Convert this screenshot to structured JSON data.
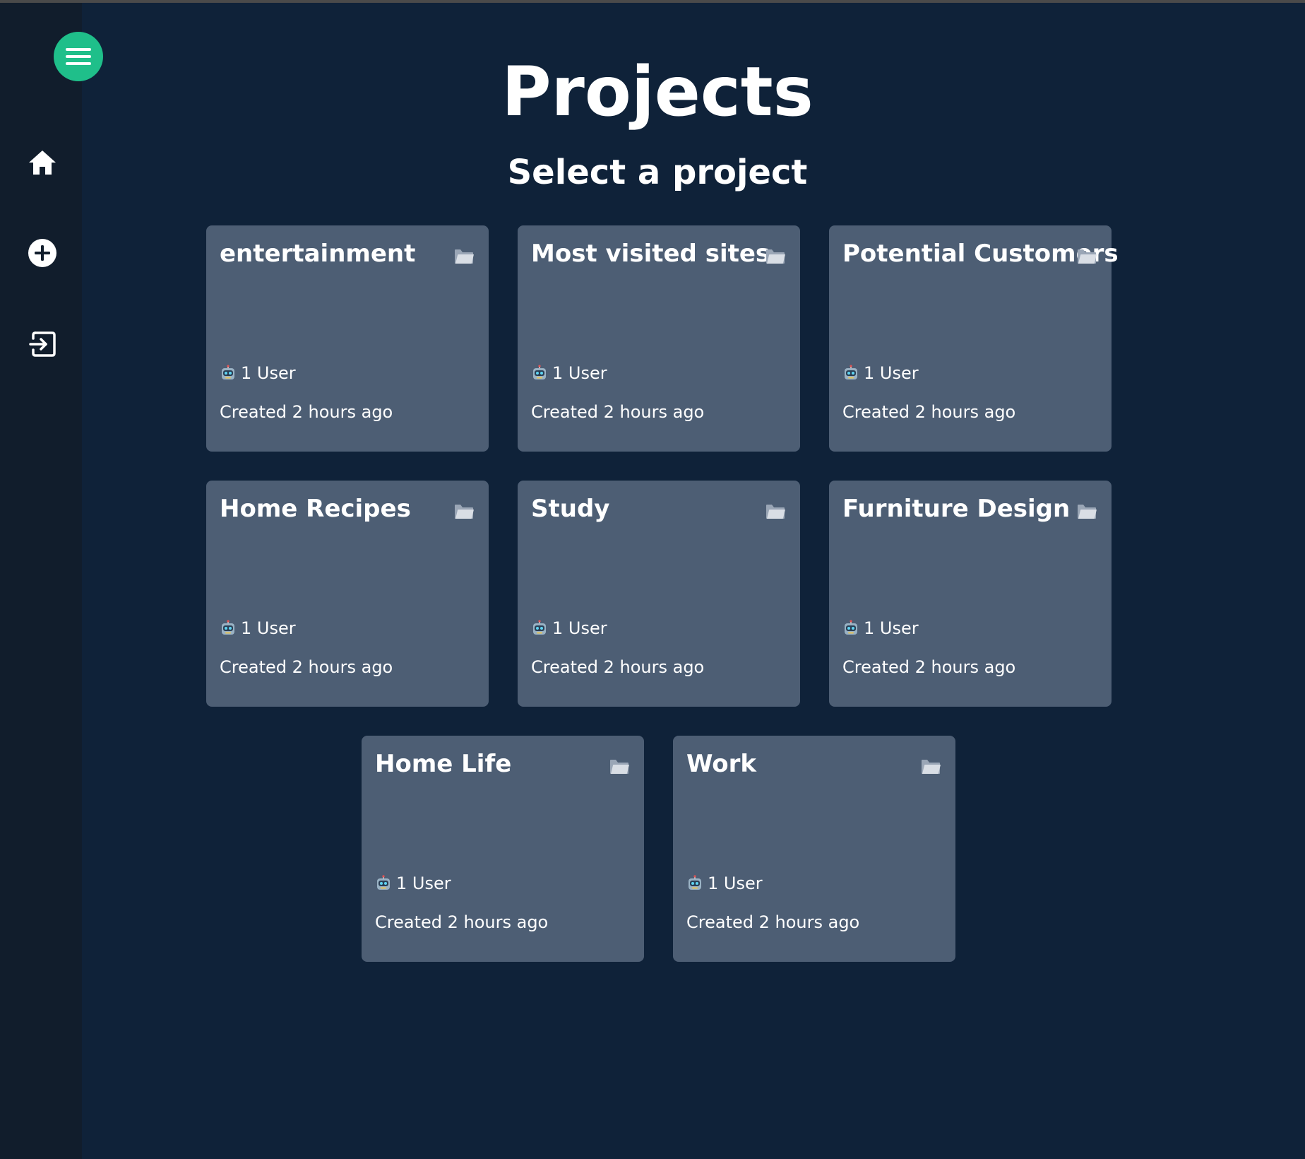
{
  "page": {
    "title": "Projects",
    "subtitle": "Select a project"
  },
  "sidebar": {
    "items": [
      {
        "name": "menu",
        "icon": "hamburger-menu-icon"
      },
      {
        "name": "home",
        "icon": "home-icon"
      },
      {
        "name": "add",
        "icon": "plus-circle-icon"
      },
      {
        "name": "logout",
        "icon": "sign-out-icon"
      }
    ],
    "accent_color": "#1fbf8a"
  },
  "projects": [
    {
      "title": "entertainment",
      "users": "1 User",
      "created": "Created 2 hours ago"
    },
    {
      "title": "Most visited sites",
      "users": "1 User",
      "created": "Created 2 hours ago"
    },
    {
      "title": "Potential Customers",
      "users": "1 User",
      "created": "Created 2 hours ago"
    },
    {
      "title": "Home Recipes",
      "users": "1 User",
      "created": "Created 2 hours ago"
    },
    {
      "title": "Study",
      "users": "1 User",
      "created": "Created 2 hours ago"
    },
    {
      "title": "Furniture Design",
      "users": "1 User",
      "created": "Created 2 hours ago"
    },
    {
      "title": "Home Life",
      "users": "1 User",
      "created": "Created 2 hours ago"
    },
    {
      "title": "Work",
      "users": "1 User",
      "created": "Created 2 hours ago"
    }
  ],
  "colors": {
    "background": "#0f2239",
    "sidebar": "#111d2c",
    "card": "#4d5e74"
  }
}
